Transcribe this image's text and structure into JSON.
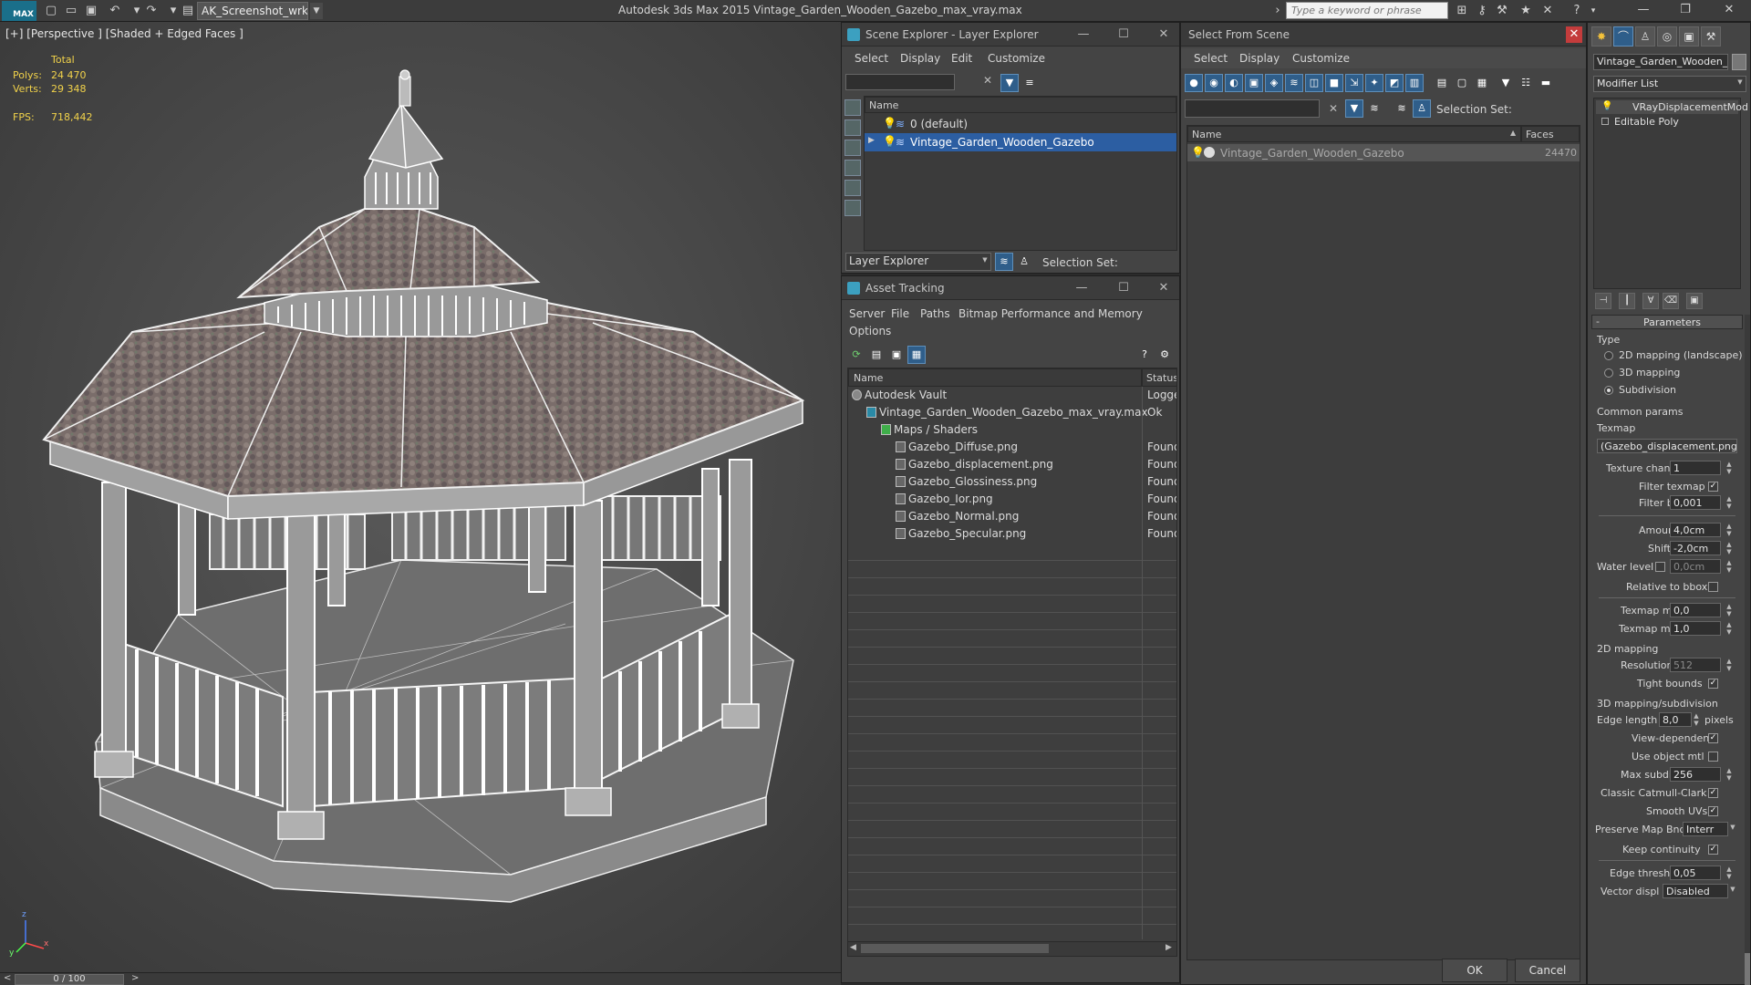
{
  "app": {
    "logo_text": "MAX",
    "workspace": "AK_Screenshot_wrksp",
    "title": "Autodesk 3ds Max  2015     Vintage_Garden_Wooden_Gazebo_max_vray.max",
    "search_placeholder": "Type a keyword or phrase"
  },
  "viewport": {
    "label": "[+] [Perspective ] [Shaded + Edged Faces ]",
    "stats": {
      "total_label": "Total",
      "polys_label": "Polys:",
      "polys_value": "24 470",
      "verts_label": "Verts:",
      "verts_value": "29 348",
      "fps_label": "FPS:",
      "fps_value": "718,442"
    },
    "axis": {
      "x": "x",
      "y": "y",
      "z": "z"
    }
  },
  "timeslider": {
    "position": "0 / 100",
    "left": "<",
    "right": ">"
  },
  "scene_explorer": {
    "title": "Scene Explorer - Layer Explorer",
    "menu": [
      "Select",
      "Display",
      "Edit",
      "Customize"
    ],
    "column_name": "Name",
    "rows": [
      {
        "label": "0 (default)",
        "selected": false
      },
      {
        "label": "Vintage_Garden_Wooden_Gazebo",
        "selected": true
      }
    ],
    "footer_combo": "Layer Explorer",
    "selection_set_label": "Selection Set:"
  },
  "asset_tracking": {
    "title": "Asset Tracking",
    "menu": [
      "Server",
      "File",
      "Paths",
      "Bitmap Performance and Memory",
      "Options"
    ],
    "col_name": "Name",
    "col_status": "Status",
    "rows": [
      {
        "name": "Autodesk Vault",
        "status": "Logged",
        "indent": 0
      },
      {
        "name": "Vintage_Garden_Wooden_Gazebo_max_vray.max",
        "status": "Ok",
        "indent": 1
      },
      {
        "name": "Maps / Shaders",
        "status": "",
        "indent": 2
      },
      {
        "name": "Gazebo_Diffuse.png",
        "status": "Found",
        "indent": 3
      },
      {
        "name": "Gazebo_displacement.png",
        "status": "Found",
        "indent": 3
      },
      {
        "name": "Gazebo_Glossiness.png",
        "status": "Found",
        "indent": 3
      },
      {
        "name": "Gazebo_Ior.png",
        "status": "Found",
        "indent": 3
      },
      {
        "name": "Gazebo_Normal.png",
        "status": "Found",
        "indent": 3
      },
      {
        "name": "Gazebo_Specular.png",
        "status": "Found",
        "indent": 3
      }
    ]
  },
  "select_from_scene": {
    "title": "Select From Scene",
    "menu": [
      "Select",
      "Display",
      "Customize"
    ],
    "selection_set_label": "Selection Set:",
    "col_name": "Name",
    "col_faces": "Faces",
    "rows": [
      {
        "name": "Vintage_Garden_Wooden_Gazebo",
        "faces": "24470"
      }
    ],
    "ok": "OK",
    "cancel": "Cancel"
  },
  "command_panel": {
    "object_name": "Vintage_Garden_Wooden_Ga",
    "modifier_list": "Modifier List",
    "stack": [
      "VRayDisplacementMod",
      "Editable Poly"
    ],
    "parameters_title": "Parameters",
    "type_label": "Type",
    "type_options": [
      "2D mapping (landscape)",
      "3D mapping",
      "Subdivision"
    ],
    "type_selected": 2,
    "common_params": "Common params",
    "texmap_label": "Texmap",
    "texmap_value": "(Gazebo_displacement.png)",
    "texture_chan_label": "Texture chan",
    "texture_chan_value": "1",
    "filter_texmap_label": "Filter texmap",
    "filter_blur_label": "Filter blur",
    "filter_blur_value": "0,001",
    "amount_label": "Amount",
    "amount_value": "4,0cm",
    "shift_label": "Shift",
    "shift_value": "-2,0cm",
    "water_level_label": "Water level",
    "water_level_value": "0,0cm",
    "relative_bbox_label": "Relative to bbox",
    "texmap_min_label": "Texmap min",
    "texmap_min_value": "0,0",
    "texmap_max_label": "Texmap max",
    "texmap_max_value": "1,0",
    "mapping2d_label": "2D mapping",
    "resolution_label": "Resolution",
    "resolution_value": "512",
    "tight_bounds_label": "Tight bounds",
    "mapping3d_label": "3D mapping/subdivision",
    "edge_length_label": "Edge length",
    "edge_length_value": "8,0",
    "pixels_label": "pixels",
    "view_dependent_label": "View-dependent",
    "use_object_mtl_label": "Use object mtl",
    "max_subdivs_label": "Max subdivs",
    "max_subdivs_value": "256",
    "catmull_label": "Classic Catmull-Clark",
    "smooth_uvs_label": "Smooth UVs",
    "preserve_map_label": "Preserve Map Bnd",
    "preserve_map_value": "Interr",
    "keep_continuity_label": "Keep continuity",
    "edge_thresh_label": "Edge thresh",
    "edge_thresh_value": "0,05",
    "vector_displ_label": "Vector displ",
    "vector_displ_value": "Disabled"
  }
}
